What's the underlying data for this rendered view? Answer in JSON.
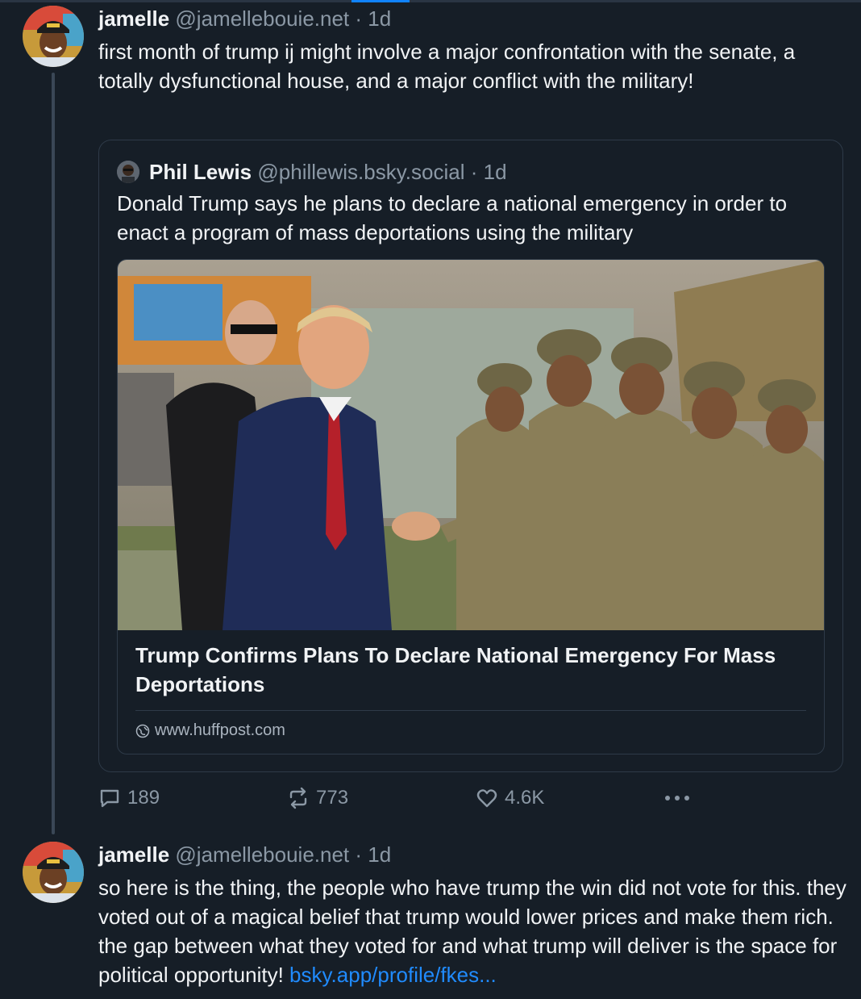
{
  "posts": [
    {
      "author_name": "jamelle",
      "handle": "@jamellebouie.net",
      "separator": "·",
      "time": "1d",
      "text": "first month of trump ij might involve a major confrontation with the senate, a totally dysfunctional house, and a major conflict with the military!",
      "quote": {
        "author_name": "Phil Lewis",
        "handle": "@phillewis.bsky.social",
        "separator": "·",
        "time": "1d",
        "text": "Donald Trump says he plans to declare a national emergency in order to enact a program of mass deportations using the military",
        "embed": {
          "title": "Trump Confirms Plans To Declare National Emergency For Mass Deportations",
          "domain": "www.huffpost.com"
        }
      },
      "actions": {
        "replies": "189",
        "reposts": "773",
        "likes": "4.6K"
      }
    },
    {
      "author_name": "jamelle",
      "handle": "@jamellebouie.net",
      "separator": "·",
      "time": "1d",
      "text": "so here is the thing, the people who have trump the win did not vote for this. they voted out of a magical belief that trump would lower prices and make them rich. the gap between what they voted for and what trump will deliver is the space for political opportunity! ",
      "link_text": "bsky.app/profile/fkes..."
    }
  ],
  "icons": {
    "reply": "speech-bubble-icon",
    "repost": "repost-arrows-icon",
    "like": "heart-icon",
    "more": "ellipsis-icon",
    "domain": "globe-icon"
  },
  "colors": {
    "background": "#161e27",
    "accent": "#1083fe",
    "link": "#208bfe",
    "muted": "#8b98a5"
  }
}
